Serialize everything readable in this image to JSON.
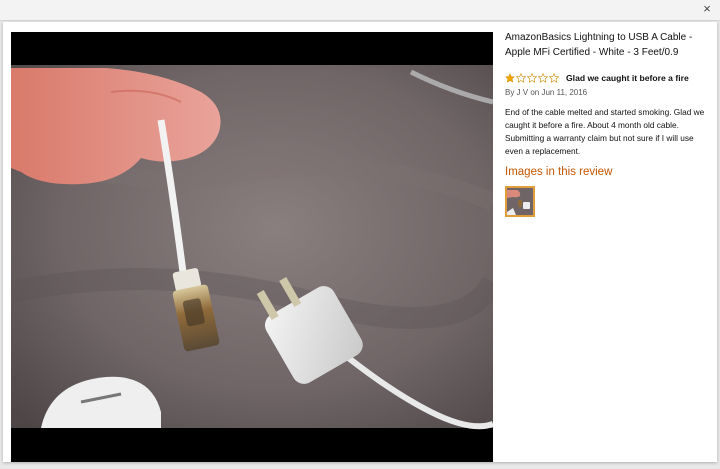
{
  "window": {
    "close_glyph": "×"
  },
  "product": {
    "title": "AmazonBasics Lightning to USB A Cable - Apple MFi Certified - White - 3 Feet/0.9"
  },
  "review": {
    "rating": 1,
    "rating_max": 5,
    "title": "Glad we caught it before a fire",
    "byline": "By J V on Jun 11, 2016",
    "body": "End of the cable melted and started smoking. Glad we caught it before a fire. About 4 month old cable. Submitting a warranty claim but not sure if I will use even a replacement."
  },
  "images_section": {
    "heading": "Images in this review"
  },
  "icons": {
    "close": "close-icon",
    "star_filled": "star-filled-icon",
    "star_empty": "star-empty-icon"
  },
  "colors": {
    "star": "#f0a400",
    "heading": "#c45500",
    "thumb_border": "#e09d3a",
    "panel": "#ffffff"
  }
}
